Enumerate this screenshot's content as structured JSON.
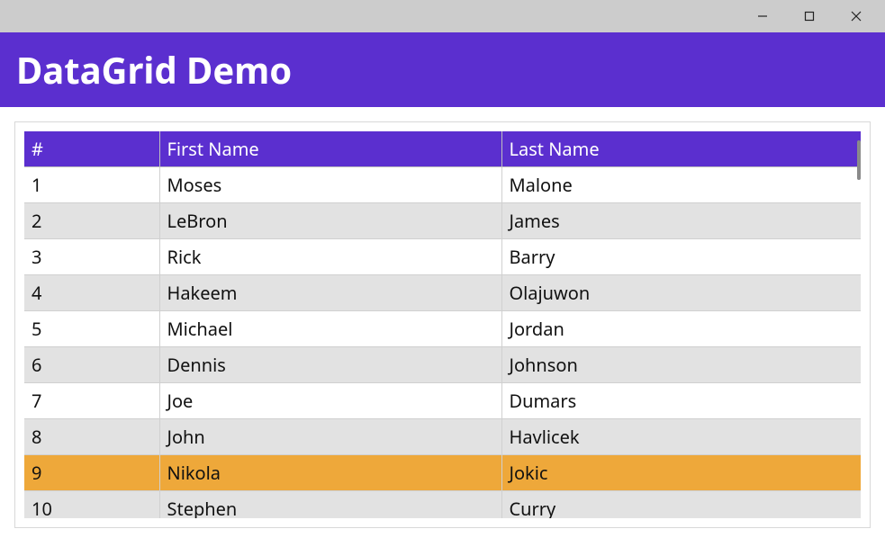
{
  "window": {
    "title": ""
  },
  "banner": {
    "title": "DataGrid Demo"
  },
  "colors": {
    "accent": "#5b2fcf",
    "row_alt": "#e2e2e2",
    "row_selected": "#eea83a"
  },
  "grid": {
    "columns": [
      "#",
      "First Name",
      "Last Name"
    ],
    "selected_index": 8,
    "rows": [
      {
        "n": "1",
        "first": "Moses",
        "last": "Malone"
      },
      {
        "n": "2",
        "first": "LeBron",
        "last": "James"
      },
      {
        "n": "3",
        "first": "Rick",
        "last": "Barry"
      },
      {
        "n": "4",
        "first": "Hakeem",
        "last": "Olajuwon"
      },
      {
        "n": "5",
        "first": "Michael",
        "last": "Jordan"
      },
      {
        "n": "6",
        "first": "Dennis",
        "last": "Johnson"
      },
      {
        "n": "7",
        "first": "Joe",
        "last": "Dumars"
      },
      {
        "n": "8",
        "first": "John",
        "last": "Havlicek"
      },
      {
        "n": "9",
        "first": "Nikola",
        "last": "Jokic"
      },
      {
        "n": "10",
        "first": "Stephen",
        "last": "Curry"
      }
    ]
  }
}
